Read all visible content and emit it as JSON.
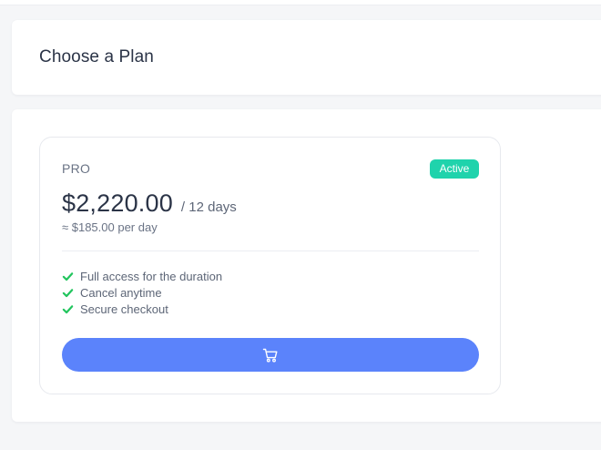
{
  "header": {
    "title": "Choose a Plan"
  },
  "plan": {
    "name": "PRO",
    "status_badge": "Active",
    "price": "$2,220.00",
    "period": "/ 12 days",
    "per_day": "≈ $185.00 per day",
    "features": [
      {
        "label": "Full access for the duration",
        "icon": "check-icon"
      },
      {
        "label": "Cancel anytime",
        "icon": "check-icon"
      },
      {
        "label": "Secure checkout",
        "icon": "check-icon"
      }
    ],
    "button_icon": "cart-icon"
  },
  "colors": {
    "page_background": "#f5f6f8",
    "accent_button": "#5b83fb",
    "badge_active": "#1fd3ac",
    "check": "#22c55e",
    "text_primary": "#2b3447",
    "text_secondary": "#6a7385"
  }
}
